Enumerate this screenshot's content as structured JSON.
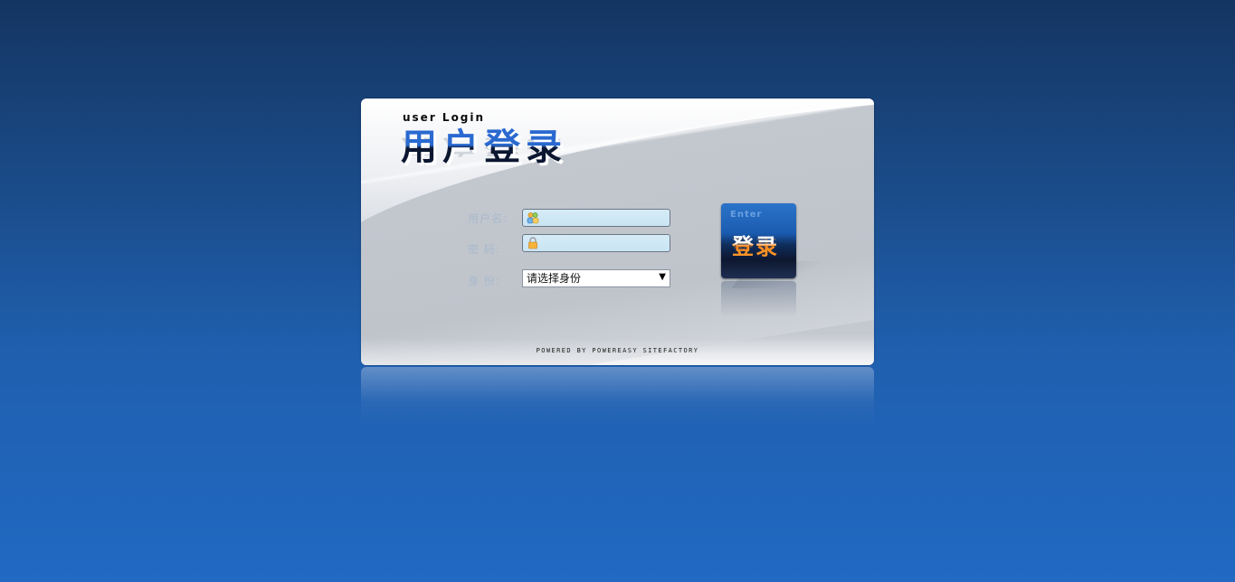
{
  "login": {
    "small_title": "user  Login",
    "big_title": "用户登录",
    "labels": {
      "username": "用户名:",
      "password": "密  码:",
      "identity": "身  份:"
    },
    "username_value": "",
    "password_value": "",
    "identity_select": {
      "selected": "请选择身份",
      "arrow": "▼"
    },
    "enter_button": {
      "en": "Enter",
      "cn": "登录"
    },
    "powered_by": "POWERED BY POWEREASY SITEFACTORY"
  },
  "colors": {
    "bg_top": "#143562",
    "bg_bottom": "#2169c3",
    "title_blue": "#2a6ad0",
    "button_orange": "#ff8a1c"
  }
}
